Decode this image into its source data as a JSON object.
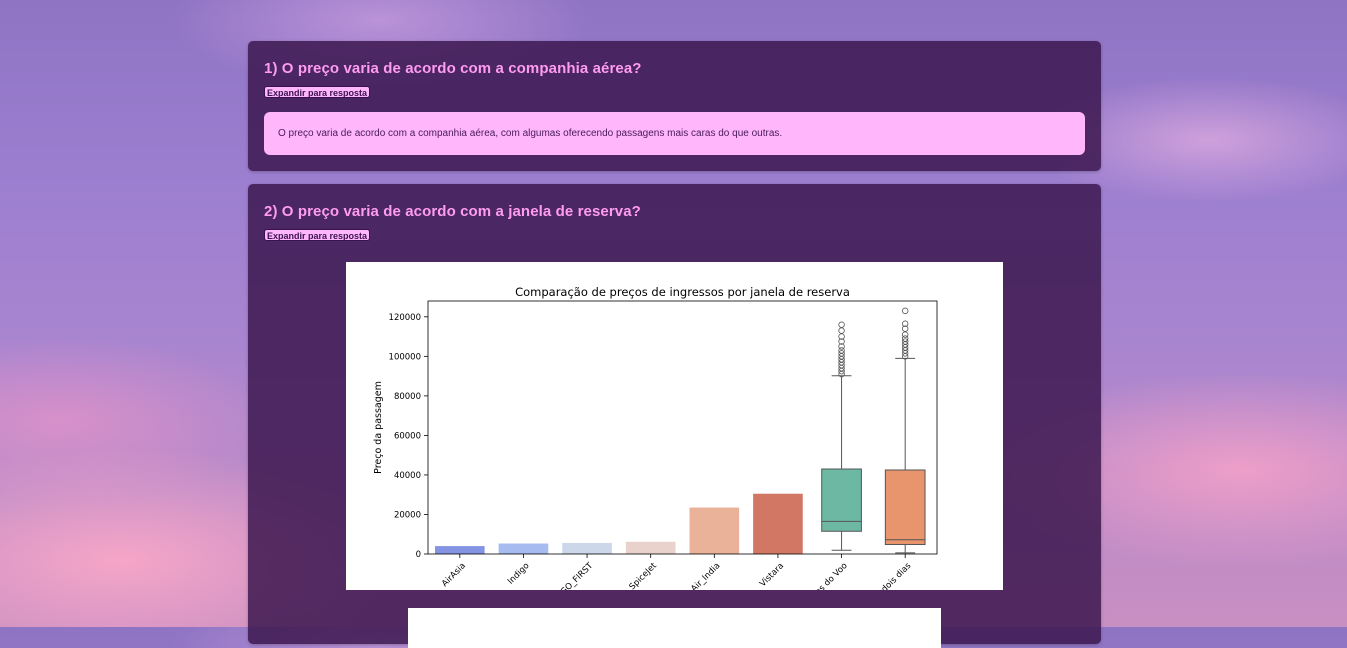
{
  "cards": [
    {
      "title": "1) O preço varia de acordo com a companhia aérea?",
      "expand_label": "Expandir para resposta",
      "answer": "O preço varia de acordo com a companhia aérea, com algumas oferecendo passagens mais caras do que outras."
    },
    {
      "title": "2) O preço varia de acordo com a janela de reserva?",
      "expand_label": "Expandir para resposta"
    }
  ],
  "chart_data": {
    "type": "bar",
    "title": "Comparação de preços de ingressos por janela de reserva",
    "xlabel": "",
    "ylabel": "Preço da passagem",
    "ylim": [
      0,
      128000
    ],
    "yticks": [
      0,
      20000,
      40000,
      60000,
      80000,
      100000,
      120000
    ],
    "grid": false,
    "bars": [
      {
        "category": "AirAsia",
        "value": 4000,
        "color": "#8494e2"
      },
      {
        "category": "Indigo",
        "value": 5300,
        "color": "#a6bbf0"
      },
      {
        "category": "GO_FIRST",
        "value": 5600,
        "color": "#ccd7ea"
      },
      {
        "category": "SpiceJet",
        "value": 6200,
        "color": "#e8d2cb"
      },
      {
        "category": "Air_India",
        "value": 23500,
        "color": "#eab298"
      },
      {
        "category": "Vistara",
        "value": 30500,
        "color": "#d27763"
      }
    ],
    "boxes": [
      {
        "category": "Dias antes do Voo",
        "whisker_low": 1900,
        "q1": 11500,
        "median": 16500,
        "q3": 43000,
        "whisker_high": 90200,
        "outliers": [
          91000,
          92500,
          94000,
          95500,
          97000,
          98500,
          100000,
          101500,
          103000,
          105000,
          107500,
          110000,
          113000,
          116000
        ],
        "color": "#6db8a3"
      },
      {
        "category": "Até dois dias",
        "whisker_low": 600,
        "q1": 4800,
        "median": 7200,
        "q3": 42500,
        "whisker_high": 99000,
        "outliers": [
          100000,
          101500,
          103000,
          104500,
          106000,
          107500,
          109000,
          111000,
          114000,
          116500,
          123000
        ],
        "color": "#e8956d"
      }
    ],
    "xtick_labels": [
      "AirAsia",
      "Indigo",
      "GO_FIRST",
      "SpiceJet",
      "Air_India",
      "Vistara",
      "Dias antes do Voo",
      "Até dois dias"
    ]
  }
}
